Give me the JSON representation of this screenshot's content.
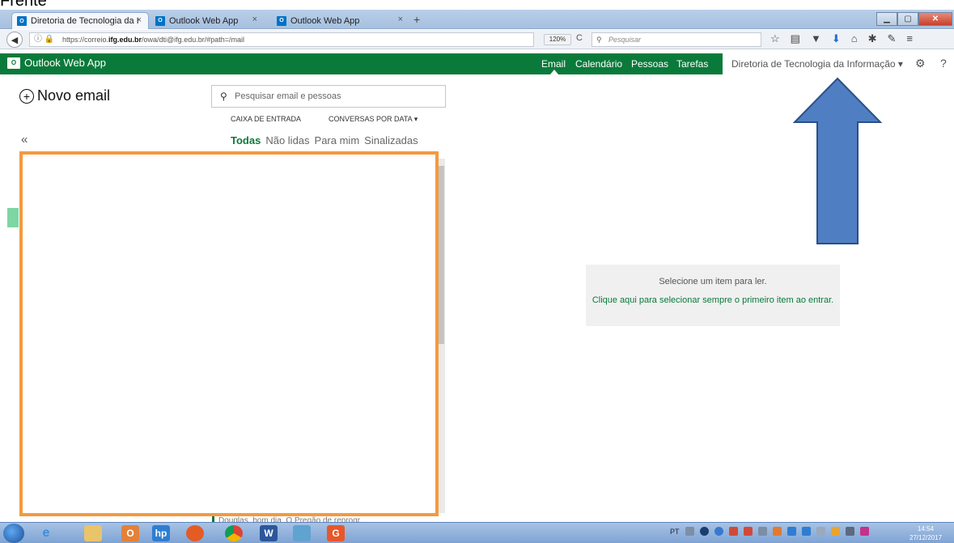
{
  "caption": "Frente",
  "browser": {
    "tabs": [
      {
        "label": "Diretoria de Tecnologia da I",
        "active": true
      },
      {
        "label": "Outlook Web App",
        "active": false
      },
      {
        "label": "Outlook Web App",
        "active": false
      }
    ],
    "tab_close": "×",
    "new_tab": "+",
    "url_prefix": "https://correio.",
    "url_host": "ifg.edu.br",
    "url_rest": "/owa/dti@ifg.edu.br/#path=/mail",
    "zoom": "120%",
    "search_placeholder": "Pesquisar"
  },
  "owa": {
    "app_name": "Outlook Web App",
    "nav": [
      "Email",
      "Calendário",
      "Pessoas",
      "Tarefas"
    ],
    "user": "Diretoria de Tecnologia da Informação ▾",
    "new_email": "Novo email",
    "collapse": "«",
    "search_placeholder": "Pesquisar email e pessoas",
    "folder": "CAIXA DE ENTRADA",
    "sort": "CONVERSAS POR DATA ▾",
    "filters": [
      "Todas",
      "Não lidas",
      "Para mim",
      "Sinalizadas"
    ],
    "peek_text": "Douglas, bom dia. O Pregão de reprogr...",
    "reading_line1": "Selecione um item para ler.",
    "reading_line2": "Clique aqui para selecionar sempre o primeiro item ao entrar."
  },
  "taskbar": {
    "language": "PT",
    "time": "14:54",
    "date": "27/12/2017"
  },
  "colors": {
    "owa_green": "#0a7a3a",
    "annotation_orange": "#f49a3e",
    "arrow_blue": "#4f7fc2"
  }
}
